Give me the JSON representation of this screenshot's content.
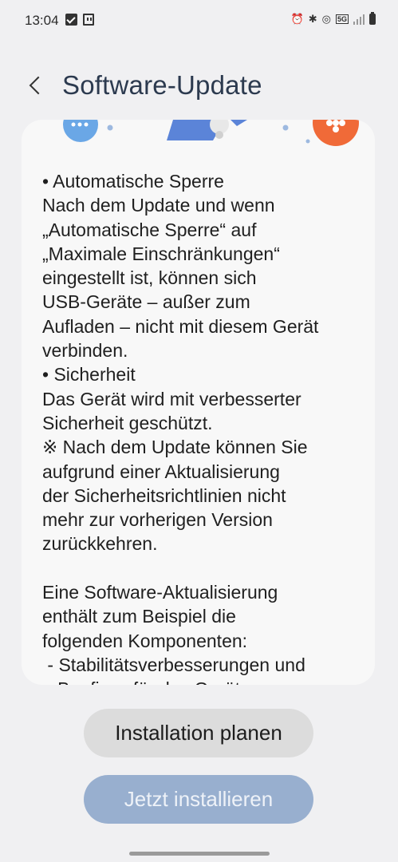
{
  "status_bar": {
    "time": "13:04",
    "network": "5G"
  },
  "header": {
    "title": "Software-Update"
  },
  "card": {
    "text": "• Automatische Sperre\nNach dem Update und wenn\n„Automatische Sperre“ auf\n„Maximale Einschränkungen“\neingestellt ist, können sich\nUSB-Geräte – außer zum\nAufladen – nicht mit diesem Gerät\nverbinden.\n• Sicherheit\nDas Gerät wird mit verbesserter\nSicherheit geschützt.\n※ Nach dem Update können Sie\naufgrund einer Aktualisierung\nder Sicherheitsrichtlinien nicht\nmehr zur vorherigen Version\nzurückkehren.\n\nEine Software-Aktualisierung\nenthält zum Beispiel die\nfolgenden Komponenten:\n - Stabilitätsverbesserungen und\n   Bugfixes für das Gerät"
  },
  "buttons": {
    "schedule_label": "Installation planen",
    "install_label": "Jetzt installieren"
  },
  "colors": {
    "title": "#2c3a4f",
    "install_button": "#98afcf",
    "schedule_button": "#dcdcdc"
  }
}
